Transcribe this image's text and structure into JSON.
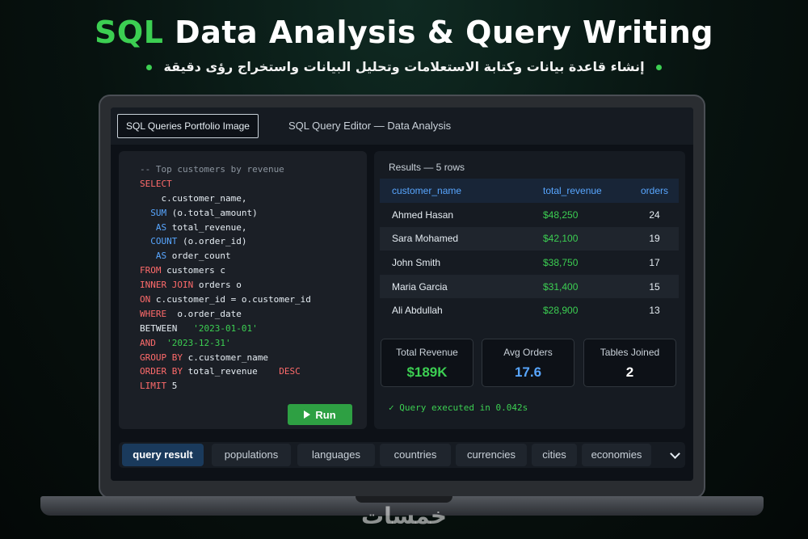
{
  "header": {
    "title_accent": "SQL",
    "title_rest": "Data Analysis & Query Writing",
    "subtitle": "إنشاء قاعدة بيانات وكتابة الاستعلامات وتحليل البيانات واستخراج رؤى دقيقة"
  },
  "screen": {
    "tab_label": "SQL Queries Portfolio Image",
    "editor_title": "SQL Query Editor — Data Analysis"
  },
  "code": {
    "comment": "-- Top customers by revenue",
    "select": "SELECT",
    "col1": "c.customer_name,",
    "sum_fn": "SUM",
    "sum_arg": " (o.total_amount)",
    "as1_kw": "AS",
    "as1_name": " total_revenue,",
    "count_fn": "COUNT",
    "count_arg": " (o.order_id)",
    "as2_kw": "AS",
    "as2_name": " order_count",
    "from_kw": "FROM",
    "from_rest": " customers c",
    "join_kw": "INNER JOIN",
    "join_rest": " orders o",
    "on_kw": "ON",
    "on_rest": " c.customer_id = o.customer_id",
    "where_kw": "WHERE",
    "where_rest": "  o.order_date",
    "between_kw": "BETWEEN",
    "between_val": "'2023-0‍1-01'",
    "and_kw": "AND",
    "and_val": "'2023-12-31'",
    "group_kw": "GROUP BY",
    "group_rest": " c.customer_name",
    "order_kw": "ORDER BY",
    "order_rest": " total_revenue",
    "desc_kw": "DESC",
    "limit_kw": "LIMIT",
    "limit_val": " 5"
  },
  "run_button": "Run",
  "results": {
    "title": "Results — 5 rows",
    "columns": [
      "customer_name",
      "total_revenue",
      "orders"
    ],
    "rows": [
      [
        "Ahmed Hasan",
        "$48,250",
        "24"
      ],
      [
        "Sara Mohamed",
        "$42,100",
        "19"
      ],
      [
        "John Smith",
        "$38,750",
        "17"
      ],
      [
        "Maria Garcia",
        "$31,400",
        "15"
      ],
      [
        "Ali Abdullah",
        "$28,900",
        "13"
      ]
    ]
  },
  "stats": [
    {
      "label": "Total Revenue",
      "value": "$189K"
    },
    {
      "label": "Avg Orders",
      "value": "17.6"
    },
    {
      "label": "Tables Joined",
      "value": "2"
    }
  ],
  "exec_status": "✓ Query executed in 0.042s",
  "bottom_tabs": [
    "query result",
    "populations",
    "languages",
    "countries",
    "currencies",
    "cities",
    "economies"
  ],
  "watermark": "خمسات",
  "colors": {
    "accent_green": "#3ccf52",
    "keyword_red": "#ff6b6b",
    "function_blue": "#58a6ff",
    "run_green": "#2ea043"
  },
  "icons": {
    "run": "play-icon",
    "exec": "check-icon",
    "more_tabs": "chevron-down-icon"
  }
}
